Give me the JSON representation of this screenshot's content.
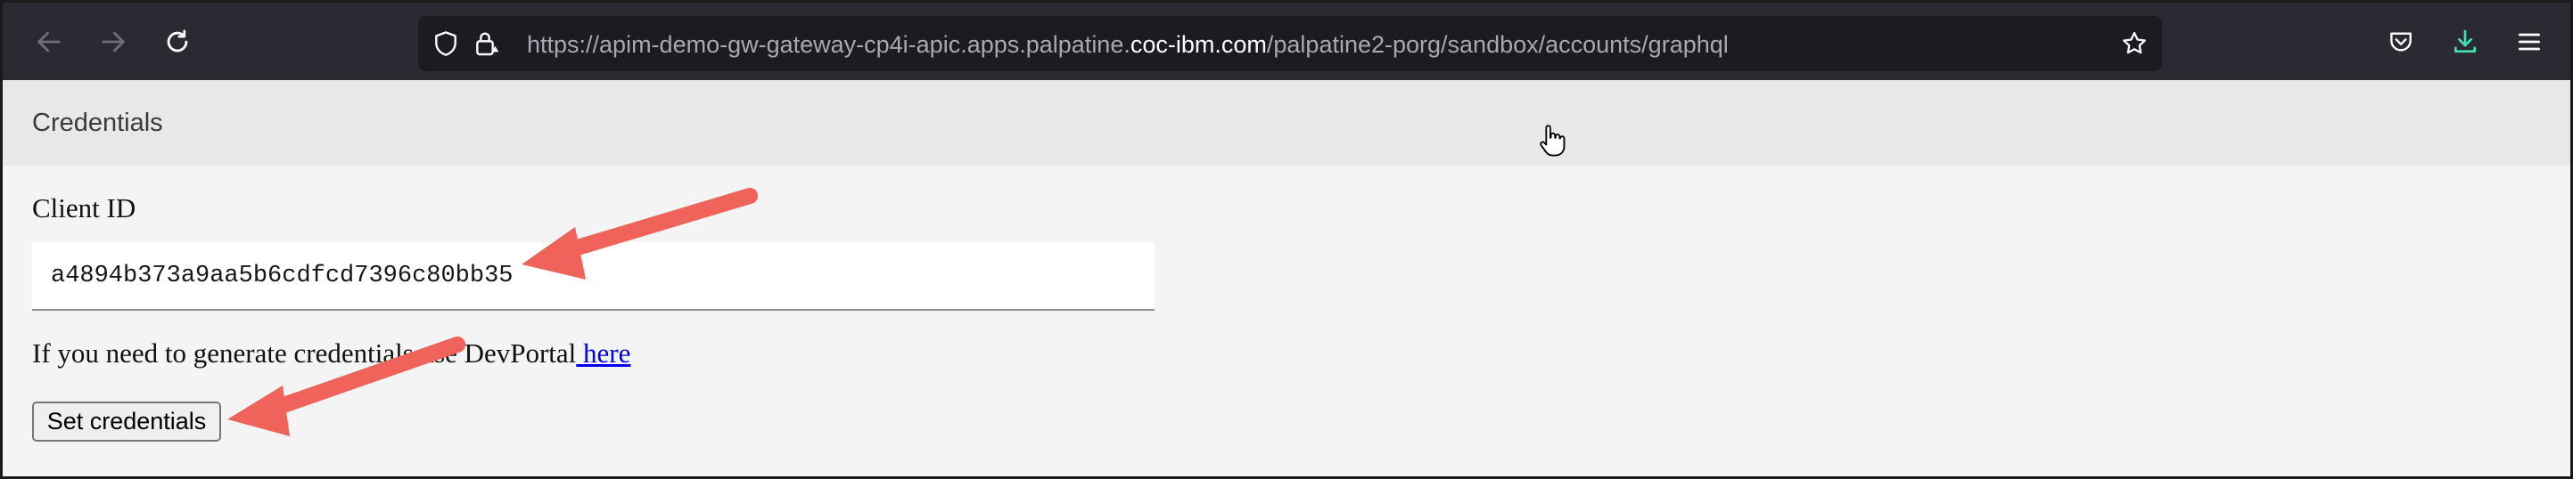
{
  "browser": {
    "url_prefix": "https://apim-demo-gw-gateway-cp4i-apic.apps.palpatine.",
    "url_host": "coc-ibm.com",
    "url_suffix": "/palpatine2-porg/sandbox/accounts/graphql",
    "icons": [
      "back-arrow-icon",
      "forward-arrow-icon",
      "reload-icon",
      "shield-icon",
      "lock-icon",
      "star-icon",
      "pocket-icon",
      "download-icon",
      "menu-icon"
    ],
    "download_icon_color": "#3fe1b0"
  },
  "credentials": {
    "title": "Credentials",
    "client_id_label": "Client ID",
    "client_id_value": "a4894b373a9aa5b6cdfcd7396c80bb35",
    "help_text": "If you need to generate credentials use DevPortal",
    "help_link": " here",
    "set_button": "Set credentials"
  },
  "annotations": {
    "arrow_color": "#f0635a"
  }
}
